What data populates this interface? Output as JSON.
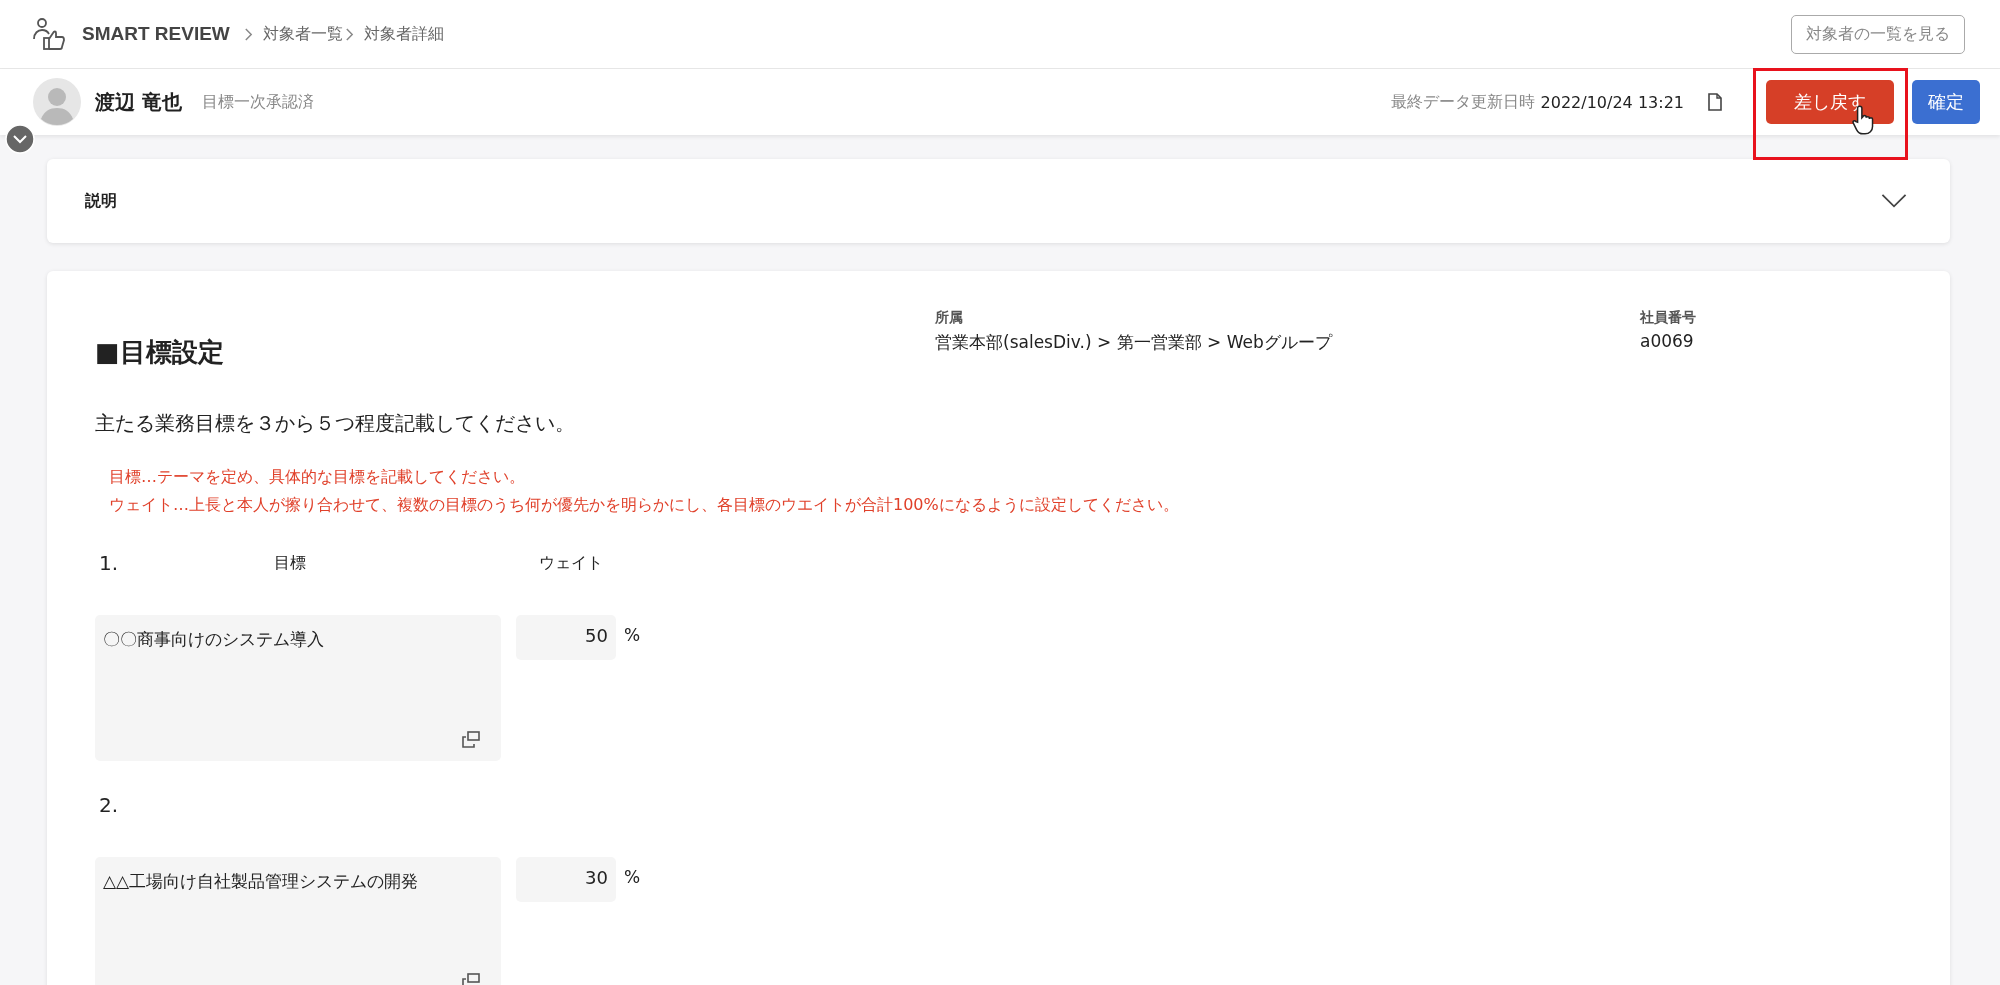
{
  "header": {
    "app_name": "SMART REVIEW",
    "breadcrumbs": [
      "対象者一覧",
      "対象者詳細"
    ],
    "list_button": "対象者の一覧を見る"
  },
  "subject": {
    "name": "渡辺 竜也",
    "status": "目標一次承認済",
    "updated_label": "最終データ更新日時",
    "updated_value": "2022/10/24 13:21",
    "actions": [
      {
        "label": "差し戻す",
        "kind": "danger",
        "highlighted": true
      },
      {
        "label": "確定",
        "kind": "primary",
        "highlighted": false
      }
    ]
  },
  "description_panel": {
    "title": "説明",
    "expanded": false
  },
  "goal_section": {
    "title": "■目標設定",
    "affiliation_label": "所属",
    "affiliation_value": "営業本部(salesDiv.) > 第一営業部 > Webグループ",
    "employee_no_label": "社員番号",
    "employee_no_value": "a0069",
    "instruction": "主たる業務目標を３から５つ程度記載してください。",
    "notes": [
      "目標…テーマを定め、具体的な目標を記載してください。",
      "ウェイト…上長と本人が擦り合わせて、複数の目標のうち何が優先かを明らかにし、各目標のウエイトが合計100%になるように設定してください。"
    ],
    "column_headers": {
      "goal": "目標",
      "weight": "ウェイト"
    },
    "goals": [
      {
        "number": "1.",
        "text": "〇〇商事向けのシステム導入",
        "weight": "50",
        "unit": "%"
      },
      {
        "number": "2.",
        "text": "△△工場向け自社製品管理システムの開発",
        "weight": "30",
        "unit": "%"
      }
    ]
  }
}
